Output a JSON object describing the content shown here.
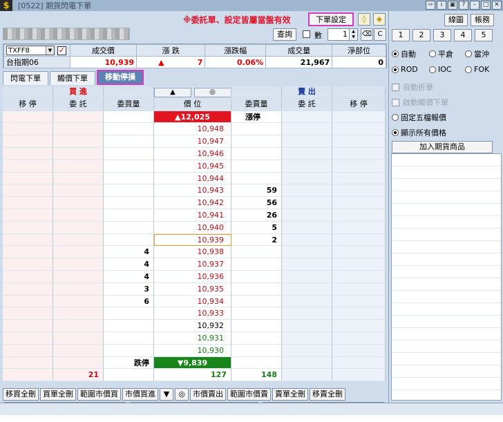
{
  "window": {
    "title": "[0522] 期貨閃電下單",
    "app_icon": "$"
  },
  "toolbar": {
    "warning": "※委託單、設定皆屬當盤有效",
    "order_settings": "下單設定",
    "query": "查詢",
    "qty_label": "數",
    "qty_value": "1",
    "clear_label": "C"
  },
  "quote": {
    "headers": [
      "成交價",
      "漲 跌",
      "漲跌幅",
      "成交量",
      "淨部位"
    ],
    "symbol": "TXFF8",
    "name": "台指期06",
    "last": "10,939",
    "change_arrow": "▲",
    "change": "7",
    "change_pct": "0.06%",
    "volume": "21,967",
    "net_position": "0"
  },
  "tabs": [
    {
      "label": "閃電下單",
      "active": false
    },
    {
      "label": "觸價下單",
      "active": false
    },
    {
      "label": "移動停損",
      "active": true
    }
  ],
  "ladder": {
    "buy_title": "買 進",
    "sell_title": "賣 出",
    "up_arrow": "▲",
    "center_icon": "◎",
    "columns": [
      "移 停",
      "委 託",
      "委買量",
      "價 位",
      "委賣量",
      "委 託",
      "移 停"
    ],
    "limit_up": {
      "price": "▲12,025",
      "sell_label": "漲停"
    },
    "limit_down": {
      "price": "▼9,839",
      "buy_label": "跌停"
    },
    "rows": [
      {
        "price": "10,948",
        "bid": "",
        "ask": "",
        "color": "red"
      },
      {
        "price": "10,947",
        "bid": "",
        "ask": "",
        "color": "red"
      },
      {
        "price": "10,946",
        "bid": "",
        "ask": "",
        "color": "red"
      },
      {
        "price": "10,945",
        "bid": "",
        "ask": "",
        "color": "red"
      },
      {
        "price": "10,944",
        "bid": "",
        "ask": "",
        "color": "red"
      },
      {
        "price": "10,943",
        "bid": "",
        "ask": "59",
        "color": "red"
      },
      {
        "price": "10,942",
        "bid": "",
        "ask": "56",
        "color": "red"
      },
      {
        "price": "10,941",
        "bid": "",
        "ask": "26",
        "color": "red"
      },
      {
        "price": "10,940",
        "bid": "",
        "ask": "5",
        "color": "red"
      },
      {
        "price": "10,939",
        "bid": "",
        "ask": "2",
        "color": "red",
        "current": true
      },
      {
        "price": "10,938",
        "bid": "4",
        "ask": "",
        "color": "red"
      },
      {
        "price": "10,937",
        "bid": "4",
        "ask": "",
        "color": "red"
      },
      {
        "price": "10,936",
        "bid": "4",
        "ask": "",
        "color": "red"
      },
      {
        "price": "10,935",
        "bid": "3",
        "ask": "",
        "color": "red"
      },
      {
        "price": "10,934",
        "bid": "6",
        "ask": "",
        "color": "red"
      },
      {
        "price": "10,933",
        "bid": "",
        "ask": "",
        "color": "red"
      },
      {
        "price": "10,932",
        "bid": "",
        "ask": "",
        "color": "black"
      },
      {
        "price": "10,931",
        "bid": "",
        "ask": "",
        "color": "green"
      },
      {
        "price": "10,930",
        "bid": "",
        "ask": "",
        "color": "green"
      }
    ],
    "totals": {
      "buy_orders": "21",
      "bid_total": "127",
      "ask_total": "148"
    }
  },
  "bottom_buttons": [
    "移買全刪",
    "買單全刪",
    "範圍市價買",
    "市價買進",
    "▼",
    "◎",
    "市價賣出",
    "範圍市價賣",
    "賣單全刪",
    "移賣全刪"
  ],
  "buy_button": "買 進",
  "sell_button": "賣 出",
  "right_panel": {
    "chart_button": "線圖",
    "account_button": "帳務",
    "qty_presets": [
      "1",
      "2",
      "3",
      "4",
      "5"
    ],
    "offset_options": [
      {
        "label": "自動",
        "checked": true
      },
      {
        "label": "平倉",
        "checked": false
      },
      {
        "label": "當沖",
        "checked": false
      }
    ],
    "tif_options": [
      {
        "label": "ROD",
        "checked": true
      },
      {
        "label": "IOC",
        "checked": false
      },
      {
        "label": "FOK",
        "checked": false
      }
    ],
    "auto_split": "自動折單",
    "enable_trigger": "啟動觸價下單",
    "fixed_five": "固定五檔報價",
    "show_all": "顯示所有價格",
    "add_futures": "加入期貨商品"
  }
}
